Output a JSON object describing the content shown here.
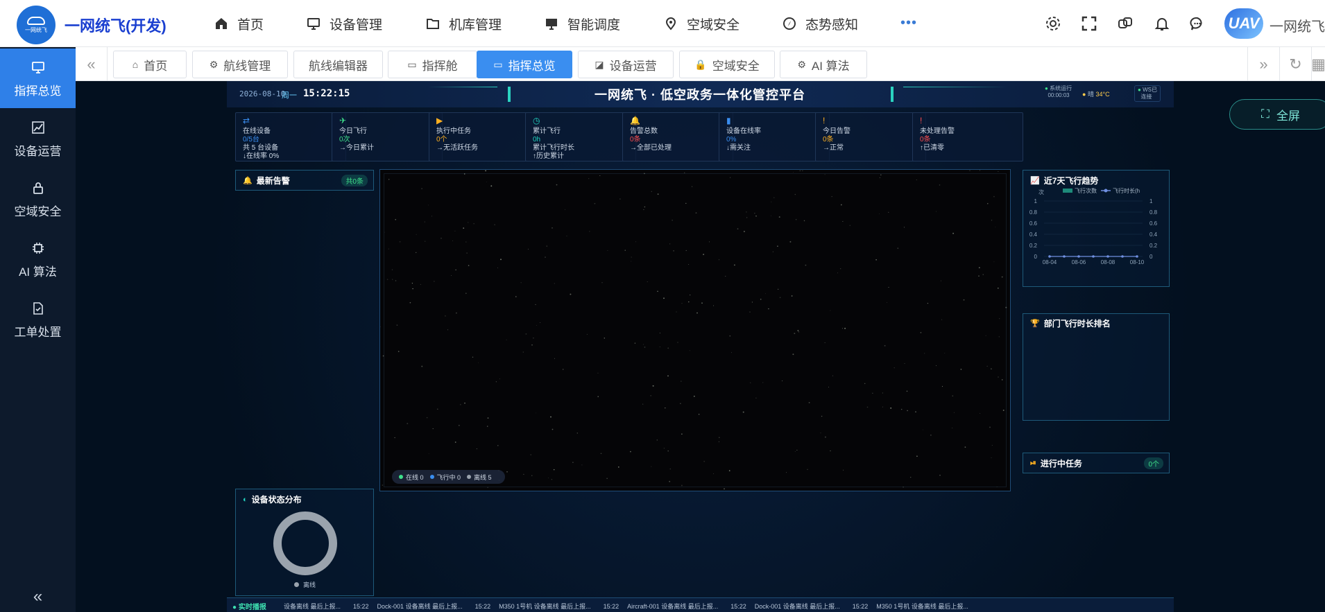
{
  "topbar": {
    "brand": "一网统飞(开发)",
    "logo_text": "一网统飞",
    "nav": [
      {
        "label": "首页",
        "icon": "home-icon"
      },
      {
        "label": "设备管理",
        "icon": "monitor-icon"
      },
      {
        "label": "机库管理",
        "icon": "folder-icon"
      },
      {
        "label": "智能调度",
        "icon": "display-icon"
      },
      {
        "label": "空域安全",
        "icon": "location-icon"
      },
      {
        "label": "态势感知",
        "icon": "compass-icon"
      }
    ],
    "more": "•••",
    "avatar_text": "UAV",
    "user_name": "一网统飞"
  },
  "sidebar": {
    "items": [
      {
        "label": "指挥总览",
        "icon": "monitor-icon",
        "active": true
      },
      {
        "label": "设备运营",
        "icon": "chart-icon"
      },
      {
        "label": "空域安全",
        "icon": "lock-icon"
      },
      {
        "label": "AI 算法",
        "icon": "chip-icon"
      },
      {
        "label": "工单处置",
        "icon": "document-check-icon"
      }
    ],
    "collapse": "«"
  },
  "tabs": [
    {
      "label": "首页",
      "icon": "⌂"
    },
    {
      "label": "航线管理",
      "icon": "⚙"
    },
    {
      "label": "航线编辑器",
      "icon": ""
    },
    {
      "label": "指挥舱",
      "icon": "▭"
    },
    {
      "label": "指挥总览",
      "icon": "▭",
      "active": true
    },
    {
      "label": "设备运营",
      "icon": "◪"
    },
    {
      "label": "空域安全",
      "icon": "🔒"
    },
    {
      "label": "AI 算法",
      "icon": "⚙"
    }
  ],
  "dashboard": {
    "date": "2026-08-10",
    "weekday": "周一",
    "time": "15:22:15",
    "title": "一网统飞 · 低空政务一体化管控平台",
    "sys_label": "系统运行",
    "sys_time": "00:00:03",
    "weather": "晴",
    "temp": "34°C",
    "ws": "WS已",
    "ws2": "连接",
    "fullscreen": "全屏",
    "stats": [
      {
        "icon": "⇄",
        "icon_color": "#3a8ef0",
        "title": "在线设备",
        "value": "0/5台",
        "value_color": "#3a8ef0",
        "line1": "共 5 台设备",
        "line2": "↓在线率 0%"
      },
      {
        "icon": "✈",
        "icon_color": "#3ee08a",
        "title": "今日飞行",
        "value": "0次",
        "value_color": "#3ee08a",
        "line1": "→今日累计",
        "line2": ""
      },
      {
        "icon": "▶",
        "icon_color": "#ffb020",
        "title": "执行中任务",
        "value": "0个",
        "value_color": "#ffb020",
        "line1": "→无活跃任务",
        "line2": ""
      },
      {
        "icon": "◷",
        "icon_color": "#22d3c0",
        "title": "累计飞行",
        "value": "0h",
        "value_color": "#22d3c0",
        "line1": "累计飞行时长",
        "line2": "↑历史累计"
      },
      {
        "icon": "🔔",
        "icon_color": "#ff4d4f",
        "title": "告警总数",
        "value": "0条",
        "value_color": "#ff4d4f",
        "line1": "→全部已处理",
        "line2": ""
      },
      {
        "icon": "▮",
        "icon_color": "#3a8ef0",
        "title": "设备在线率",
        "value": "0%",
        "value_color": "#3a8ef0",
        "line1": "↓需关注",
        "line2": ""
      },
      {
        "icon": "!",
        "icon_color": "#ffb020",
        "title": "今日告警",
        "value": "0条",
        "value_color": "#ffb020",
        "line1": "→正常",
        "line2": ""
      },
      {
        "icon": "!",
        "icon_color": "#ff4d4f",
        "title": "未处理告警",
        "value": "0条",
        "value_color": "#ff4d4f",
        "line1": "↑已清零",
        "line2": ""
      }
    ],
    "alerts": {
      "title": "最新告警",
      "badge": "共0条"
    },
    "status_dist": {
      "title": "设备状态分布",
      "legend": "离线"
    },
    "map_legend": [
      {
        "label": "在线 0",
        "color": "#3ee08a"
      },
      {
        "label": "飞行中 0",
        "color": "#3a8ef0"
      },
      {
        "label": "离线 5",
        "color": "#9aa3ad"
      }
    ],
    "trend": {
      "title": "近7天飞行趋势",
      "unit": "次",
      "legend1": "飞行次数",
      "legend2": "飞行时长(h",
      "xticks": [
        "08-04",
        "08-06",
        "08-08",
        "08-10"
      ],
      "yticks": [
        "1",
        "0.8",
        "0.6",
        "0.4",
        "0.2",
        "0"
      ]
    },
    "rank": {
      "title": "部门飞行时长排名"
    },
    "tasks": {
      "title": "进行中任务",
      "badge": "0个"
    },
    "ticker": {
      "label": "实时播报",
      "items": [
        {
          "time": "",
          "text": "设备离线 最后上报..."
        },
        {
          "time": "15:22",
          "text": "Dock-001 设备离线 最后上报..."
        },
        {
          "time": "15:22",
          "text": "M350 1号机 设备离线 最后上报..."
        },
        {
          "time": "15:22",
          "text": "Aircraft-001 设备离线 最后上报..."
        },
        {
          "time": "15:22",
          "text": "Dock-001 设备离线 最后上报..."
        },
        {
          "time": "15:22",
          "text": "M350 1号机 设备离线 最后上报..."
        }
      ]
    }
  },
  "chart_data": {
    "type": "line",
    "title": "近7天飞行趋势",
    "x": [
      "08-04",
      "08-05",
      "08-06",
      "08-07",
      "08-08",
      "08-09",
      "08-10"
    ],
    "xticks": [
      "08-04",
      "08-06",
      "08-08",
      "08-10"
    ],
    "series": [
      {
        "name": "飞行次数",
        "values": [
          0,
          0,
          0,
          0,
          0,
          0,
          0
        ]
      },
      {
        "name": "飞行时长(h",
        "values": [
          0,
          0,
          0,
          0,
          0,
          0,
          0
        ]
      }
    ],
    "ylabel": "次",
    "ylim": [
      0,
      1
    ]
  }
}
